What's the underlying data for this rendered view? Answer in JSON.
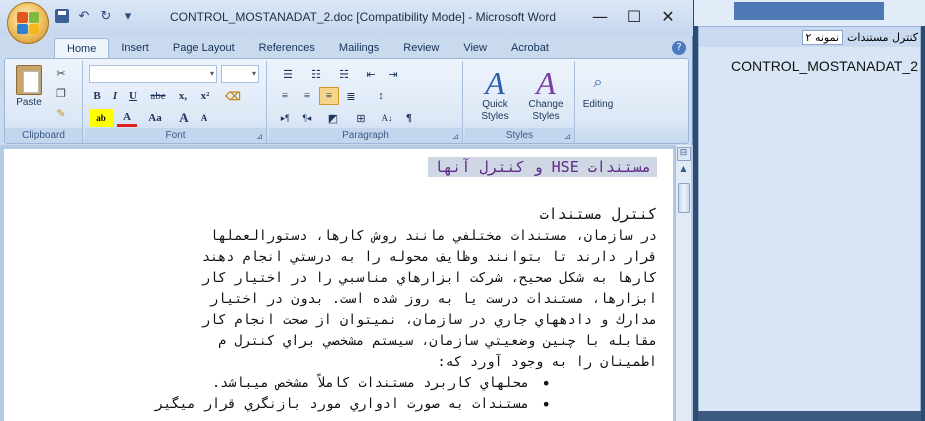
{
  "window": {
    "title": "CONTROL_MOSTANADAT_2.doc [Compatibility Mode] - Microsoft Word",
    "minimize": "—",
    "maximize": "☐",
    "close": "✕"
  },
  "quick_access": {
    "undo": "↶",
    "redo": "↻",
    "dropdown": "▾"
  },
  "tabs": [
    "Home",
    "Insert",
    "Page Layout",
    "References",
    "Mailings",
    "Review",
    "View",
    "Acrobat"
  ],
  "ribbon": {
    "clipboard": {
      "paste": "Paste",
      "label": "Clipboard"
    },
    "font": {
      "label": "Font",
      "bold": "B",
      "italic": "I",
      "underline": "U",
      "strike": "abe",
      "subscript": "x,",
      "superscript": "x²",
      "change_case": "Aa",
      "grow": "A",
      "shrink": "A"
    },
    "paragraph": {
      "label": "Paragraph"
    },
    "styles": {
      "quick_styles": "Quick Styles",
      "change_styles": "Change Styles",
      "label": "Styles"
    },
    "editing": {
      "label": "Editing"
    }
  },
  "document": {
    "heading": "مستندات HSE و کنترل آنها",
    "subheading": "کنترل مستندات",
    "lines": [
      "در سازمان، مستندات مختلفي مانند روش كارها، دستورالعملها",
      "قرار دارند تا بتوانند وظايف محوله را به درستي انجام دهند",
      "كارها به شكل صحيح، شركت ابزارهاي مناسبي را در اختيار كار",
      "ابزارها، مستندات درست يا به روز شده است. بدون در اختيار",
      "مدارك و دادههاي جاري در سازمان، نميتوان از صحت انجام كار",
      "مقابله با چنين وضعيتي سازمان، سيستم مشخصي براي كنترل م",
      "اطمينان را به وجود آورد كه:"
    ],
    "bullets": [
      "محلهاي كاربرد مستندات كاملاً مشخص ميباشد.",
      "مستندات به صورت ادواري مورد بازنگري قرار ميگير"
    ]
  },
  "right_panel": {
    "search_label": "کنترل مستندات",
    "search_highlight": "نمونه ۲",
    "item": "CONTROL_MOSTANADAT_2"
  }
}
